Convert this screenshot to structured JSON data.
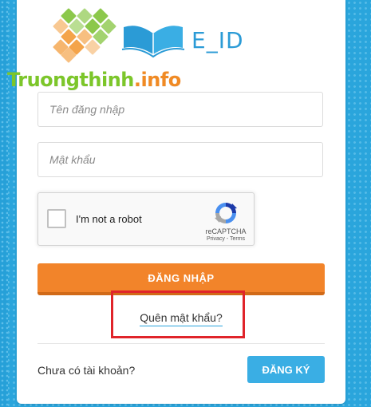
{
  "logo": {
    "text": "E_ID",
    "colors": {
      "orange": "#f4a44a",
      "green": "#8cc84b",
      "blue": "#2b9bd6"
    }
  },
  "watermark": {
    "main": "Truongthinh",
    "dot": ".",
    "suffix": "info"
  },
  "form": {
    "username_placeholder": "Tên đăng nhập",
    "password_placeholder": "Mật khẩu",
    "captcha": {
      "label": "I'm not a robot",
      "brand": "reCAPTCHA",
      "links": "Privacy - Terms"
    },
    "login_label": "ĐĂNG NHẬP",
    "forgot_label": "Quên mật khẩu?",
    "no_account_label": "Chưa có tài khoản?",
    "register_label": "ĐĂNG KÝ"
  },
  "colors": {
    "background": "#2aa5dc",
    "login_button": "#f2842a",
    "register_button": "#3aaee4",
    "highlight_border": "#e0242a"
  }
}
